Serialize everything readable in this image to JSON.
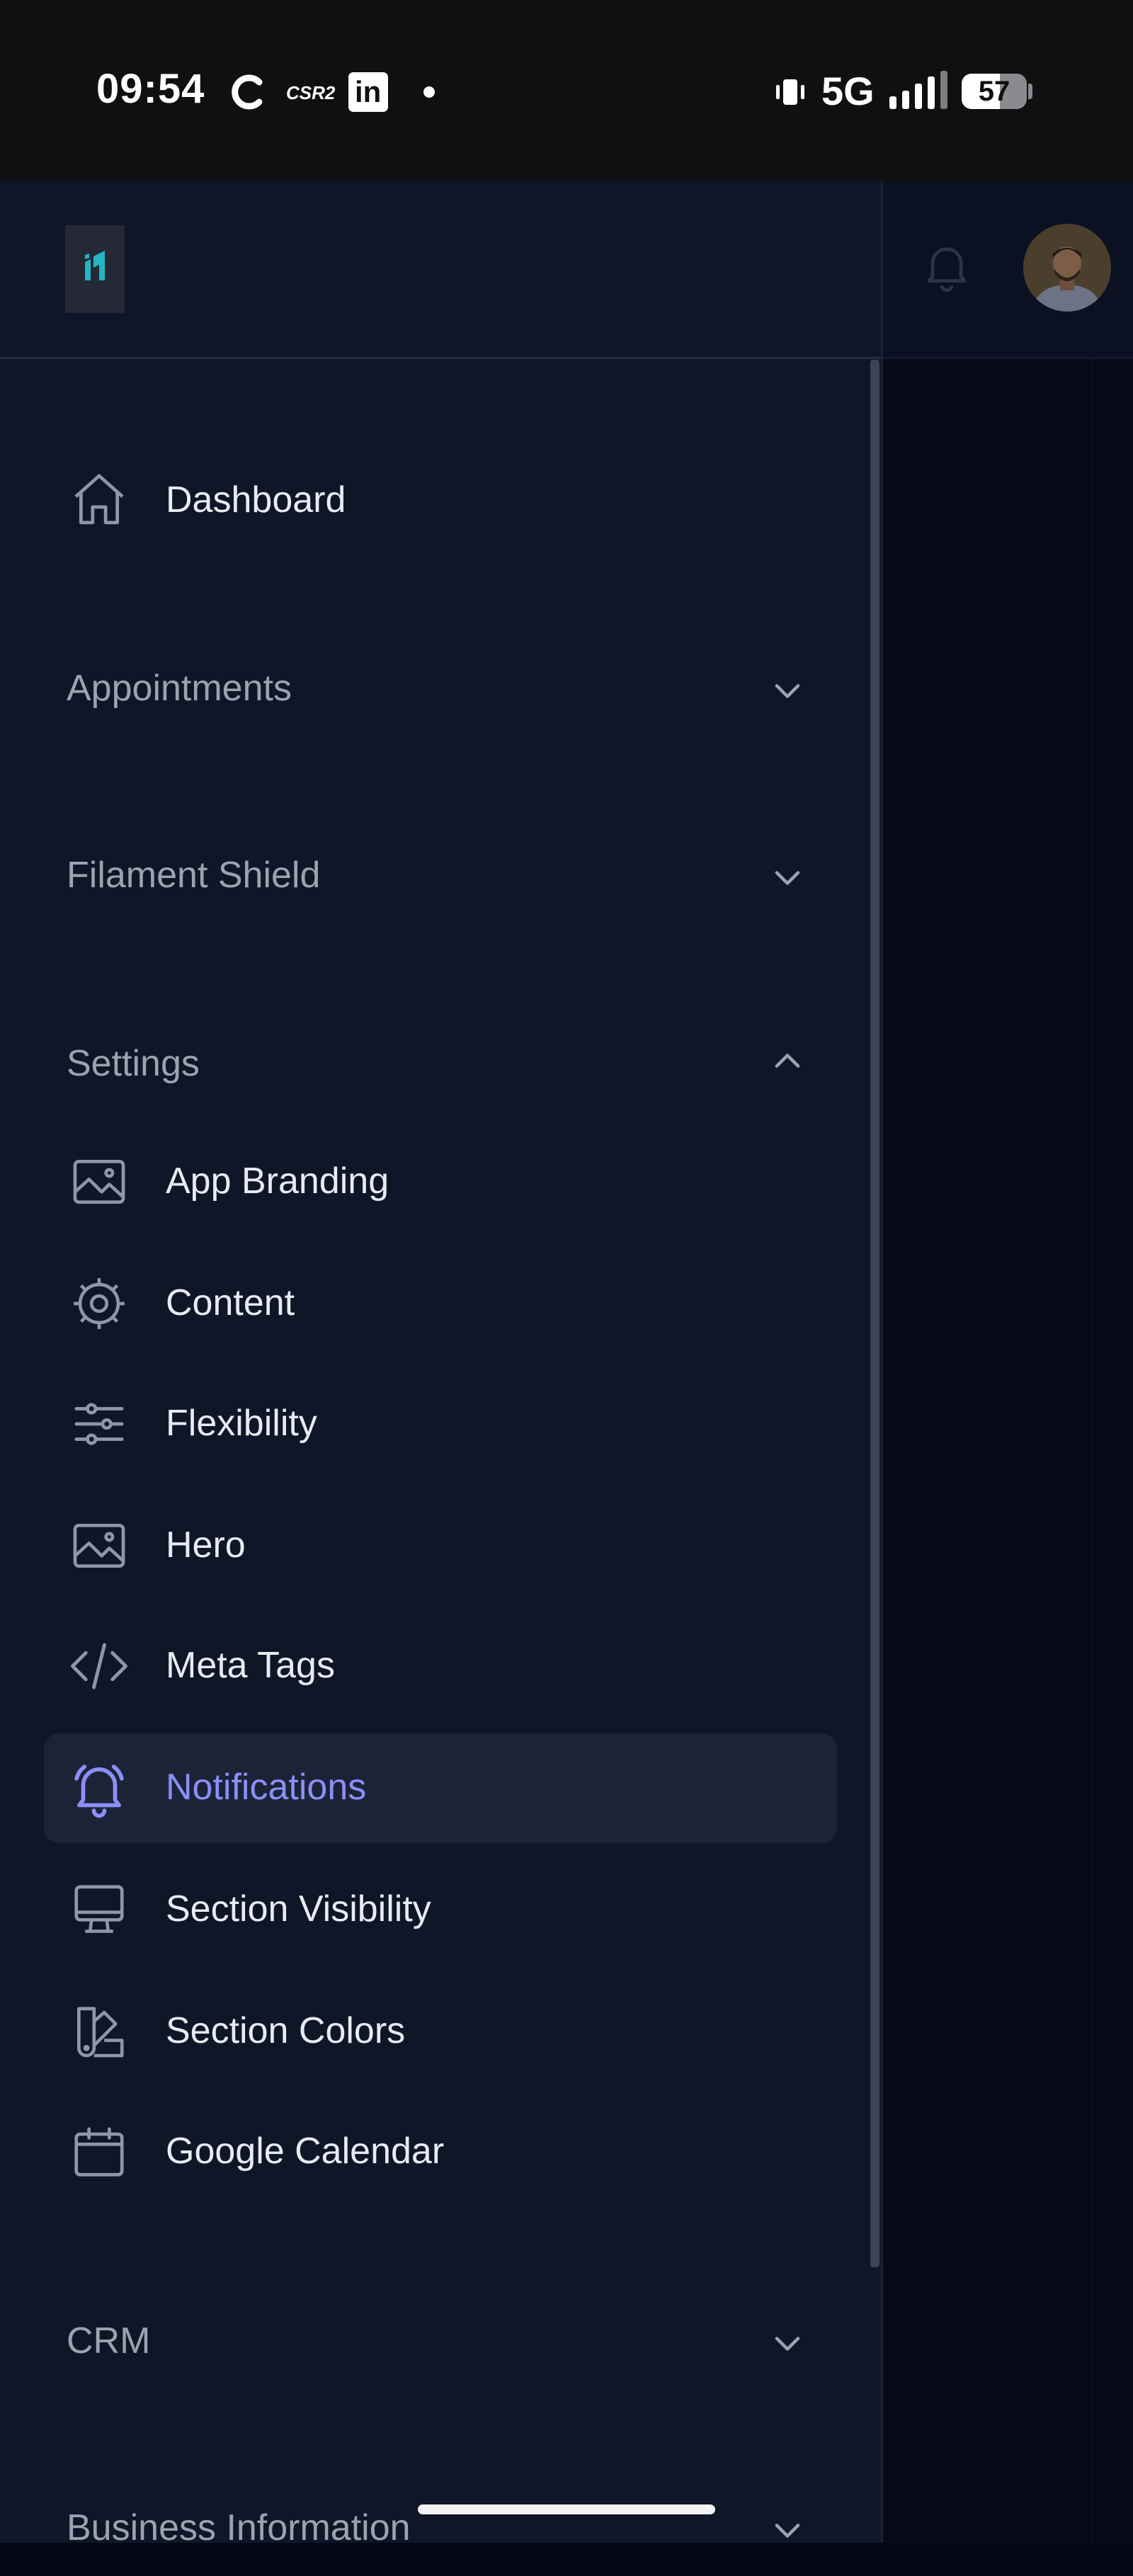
{
  "status_bar": {
    "time": "09:54",
    "app_icons": [
      "c-app-icon",
      "csr2-icon",
      "linkedin-icon",
      "notification-dot-icon"
    ],
    "csr2_label": "CSR2",
    "linkedin_label": "in",
    "network": "5G",
    "battery": "57"
  },
  "header": {
    "logo_icon": "app-logo-icon",
    "bell_icon": "bell-icon",
    "avatar_icon": "user-avatar"
  },
  "sidebar": {
    "dashboard": {
      "label": "Dashboard",
      "icon": "home-icon"
    },
    "groups": {
      "appointments": {
        "label": "Appointments",
        "expanded": false
      },
      "filament_shield": {
        "label": "Filament Shield",
        "expanded": false
      },
      "settings": {
        "label": "Settings",
        "expanded": true
      },
      "crm": {
        "label": "CRM",
        "expanded": false
      },
      "business_information": {
        "label": "Business Information",
        "expanded": false
      }
    },
    "settings_items": [
      {
        "label": "App Branding",
        "icon": "image-icon"
      },
      {
        "label": "Content",
        "icon": "cog-icon"
      },
      {
        "label": "Flexibility",
        "icon": "sliders-icon"
      },
      {
        "label": "Hero",
        "icon": "image-icon"
      },
      {
        "label": "Meta Tags",
        "icon": "code-icon"
      },
      {
        "label": "Notifications",
        "icon": "bell-alert-icon",
        "active": true
      },
      {
        "label": "Section Visibility",
        "icon": "monitor-icon"
      },
      {
        "label": "Section Colors",
        "icon": "swatch-icon"
      },
      {
        "label": "Google Calendar",
        "icon": "calendar-icon"
      }
    ]
  },
  "colors": {
    "sidebar_bg": "#0f1628",
    "active_bg": "#1d2336",
    "active_accent": "#8b8ff8",
    "text": "#e8ebf1",
    "muted": "#9ca3af",
    "icon": "#8e96a8"
  }
}
